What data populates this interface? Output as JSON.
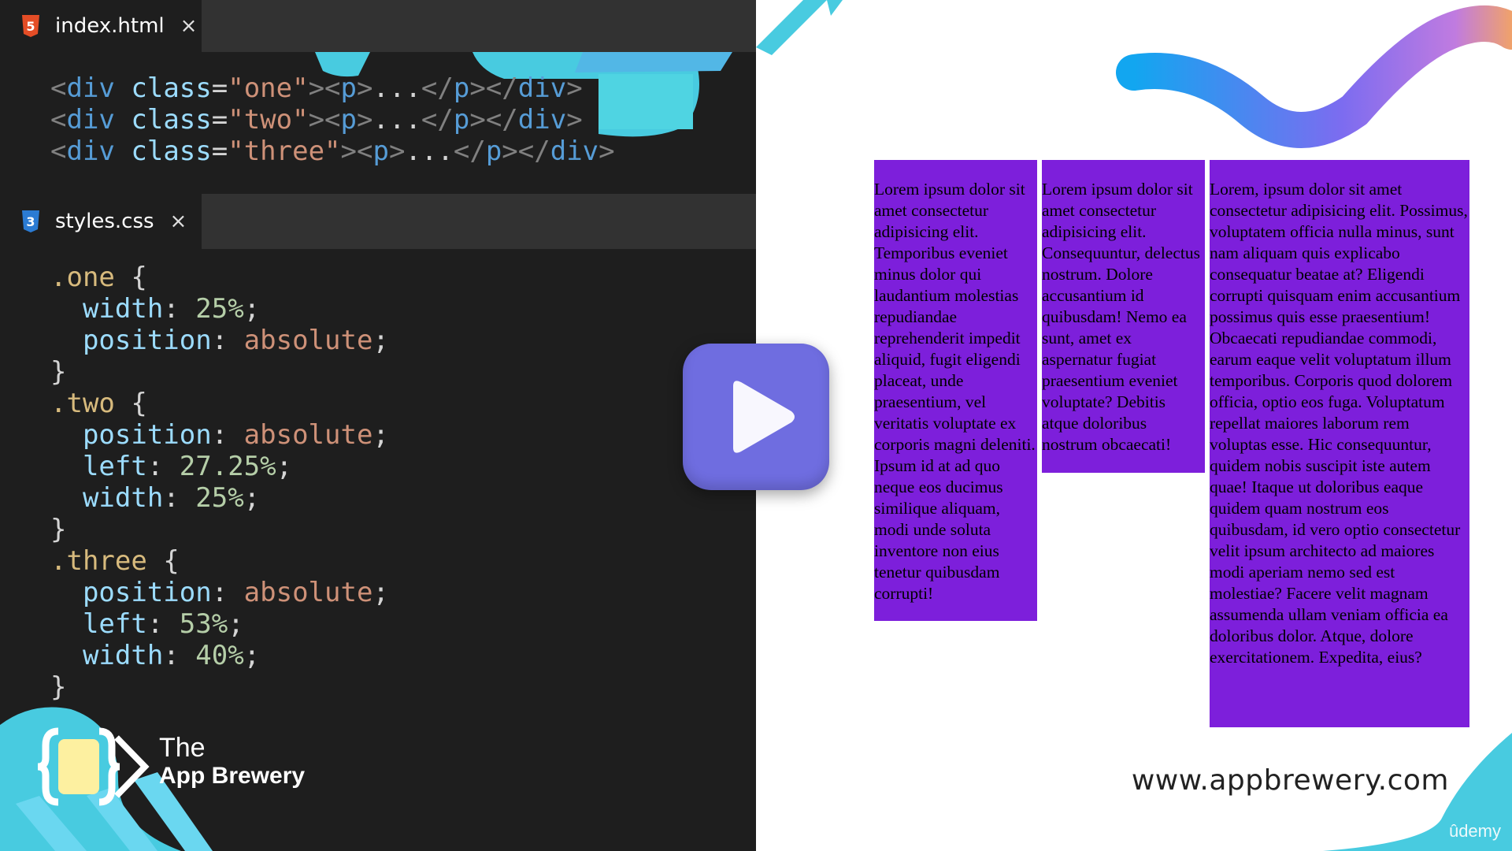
{
  "editor": {
    "html_tab": {
      "label": "index.html",
      "close": "×",
      "icon": "html5-file-icon"
    },
    "css_tab": {
      "label": "styles.css",
      "close": "×",
      "icon": "css3-file-icon"
    },
    "html_lines": [
      [
        [
          "<",
          "punc"
        ],
        [
          "div",
          "tag"
        ],
        [
          " class",
          "attr"
        ],
        [
          "=",
          "text"
        ],
        [
          "\"one\"",
          "str"
        ],
        [
          "><",
          "punc"
        ],
        [
          "p",
          "tag"
        ],
        [
          ">",
          "punc"
        ],
        [
          "...",
          "text"
        ],
        [
          "</",
          "punc"
        ],
        [
          "p",
          "tag"
        ],
        [
          "></",
          "punc"
        ],
        [
          "div",
          "tag"
        ],
        [
          ">",
          "punc"
        ]
      ],
      [
        [
          "<",
          "punc"
        ],
        [
          "div",
          "tag"
        ],
        [
          " class",
          "attr"
        ],
        [
          "=",
          "text"
        ],
        [
          "\"two\"",
          "str"
        ],
        [
          "><",
          "punc"
        ],
        [
          "p",
          "tag"
        ],
        [
          ">",
          "punc"
        ],
        [
          "...",
          "text"
        ],
        [
          "</",
          "punc"
        ],
        [
          "p",
          "tag"
        ],
        [
          "></",
          "punc"
        ],
        [
          "div",
          "tag"
        ],
        [
          ">",
          "punc"
        ]
      ],
      [
        [
          "<",
          "punc"
        ],
        [
          "div",
          "tag"
        ],
        [
          " class",
          "attr"
        ],
        [
          "=",
          "text"
        ],
        [
          "\"three\"",
          "str"
        ],
        [
          "><",
          "punc"
        ],
        [
          "p",
          "tag"
        ],
        [
          ">",
          "punc"
        ],
        [
          "...",
          "text"
        ],
        [
          "</",
          "punc"
        ],
        [
          "p",
          "tag"
        ],
        [
          "></",
          "punc"
        ],
        [
          "div",
          "tag"
        ],
        [
          ">",
          "punc"
        ]
      ]
    ],
    "css_lines": [
      [
        [
          ".one",
          "sel"
        ],
        [
          " {",
          "brace"
        ]
      ],
      [
        [
          "  width",
          "prop"
        ],
        [
          ": ",
          "text"
        ],
        [
          "25%",
          "num"
        ],
        [
          ";",
          "text"
        ]
      ],
      [
        [
          "  position",
          "prop"
        ],
        [
          ": ",
          "text"
        ],
        [
          "absolute",
          "val"
        ],
        [
          ";",
          "text"
        ]
      ],
      [
        [
          "}",
          "brace"
        ]
      ],
      [
        [
          ".two",
          "sel"
        ],
        [
          " {",
          "brace"
        ]
      ],
      [
        [
          "  position",
          "prop"
        ],
        [
          ": ",
          "text"
        ],
        [
          "absolute",
          "val"
        ],
        [
          ";",
          "text"
        ]
      ],
      [
        [
          "  left",
          "prop"
        ],
        [
          ": ",
          "text"
        ],
        [
          "27.25%",
          "num"
        ],
        [
          ";",
          "text"
        ]
      ],
      [
        [
          "  width",
          "prop"
        ],
        [
          ": ",
          "text"
        ],
        [
          "25%",
          "num"
        ],
        [
          ";",
          "text"
        ]
      ],
      [
        [
          "}",
          "brace"
        ]
      ],
      [
        [
          ".three",
          "sel"
        ],
        [
          " {",
          "brace"
        ]
      ],
      [
        [
          "  position",
          "prop"
        ],
        [
          ": ",
          "text"
        ],
        [
          "absolute",
          "val"
        ],
        [
          ";",
          "text"
        ]
      ],
      [
        [
          "  left",
          "prop"
        ],
        [
          ": ",
          "text"
        ],
        [
          "53%",
          "num"
        ],
        [
          ";",
          "text"
        ]
      ],
      [
        [
          "  width",
          "prop"
        ],
        [
          ": ",
          "text"
        ],
        [
          "40%",
          "num"
        ],
        [
          ";",
          "text"
        ]
      ],
      [
        [
          "}",
          "brace"
        ]
      ]
    ]
  },
  "brand": {
    "line1": "The",
    "line2": "App Brewery"
  },
  "preview": {
    "col_one_text": "Lorem ipsum dolor sit amet consectetur adipisicing elit. Temporibus eveniet minus dolor qui laudantium molestias repudiandae reprehenderit impedit aliquid, fugit eligendi placeat, unde praesentium, vel veritatis voluptate ex corporis magni deleniti. Ipsum id at ad quo neque eos ducimus similique aliquam, modi unde soluta inventore non eius tenetur quibusdam corrupti!",
    "col_two_text": "Lorem ipsum dolor sit amet consectetur adipisicing elit. Consequuntur, delectus nostrum. Dolore accusantium id quibusdam! Nemo ea sunt, amet ex aspernatur fugiat praesentium eveniet voluptate? Debitis atque doloribus nostrum obcaecati!",
    "col_three_text": "Lorem, ipsum dolor sit amet consectetur adipisicing elit. Possimus, voluptatem officia nulla minus, sunt nam aliquam quis explicabo consequatur beatae at? Eligendi corrupti quisquam enim accusantium possimus quis esse praesentium! Obcaecati repudiandae commodi, earum eaque velit voluptatum illum temporibus. Corporis quod dolorem officia, optio eos fuga. Voluptatum repellat maiores laborum rem voluptas esse. Hic consequuntur, quidem nobis suscipit iste autem quae! Itaque ut doloribus eaque quidem quam nostrum eos quibusdam, id vero optio consectetur velit ipsum architecto ad maiores modi aperiam nemo sed est molestiae? Facere velit magnam assumenda ullam veniam officia ea doloribus dolor. Atque, dolore exercitationem. Expedita, eius?",
    "url": "www.appbrewery.com",
    "watermark": "ûdemy"
  },
  "colors": {
    "column_purple": "#7d1fdb",
    "editor_bg": "#1e1e1e",
    "accent_blue": "#48cbe0",
    "play_button": "#6f6de0"
  },
  "play": {
    "icon": "play-icon"
  }
}
